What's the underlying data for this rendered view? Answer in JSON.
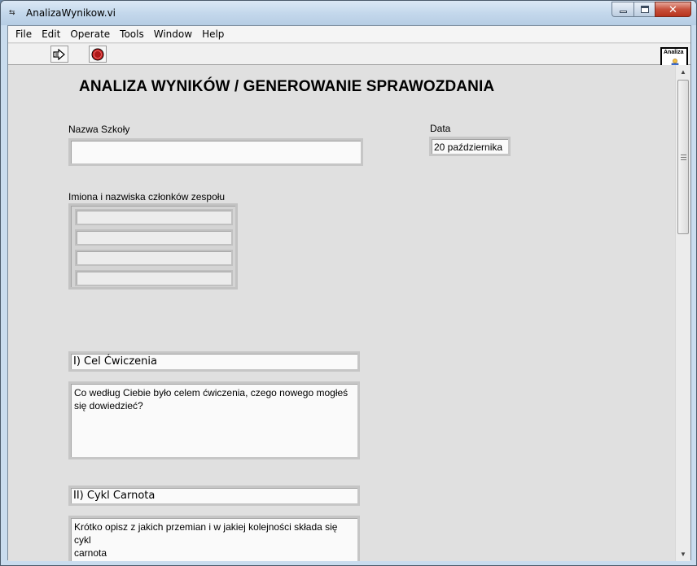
{
  "window": {
    "title": "AnalizaWynikow.vi",
    "title_icon": "labview-vi-icon"
  },
  "menu": {
    "items": [
      "File",
      "Edit",
      "Operate",
      "Tools",
      "Window",
      "Help"
    ]
  },
  "toolbar": {
    "run_icon": "run-arrow-icon",
    "abort_icon": "abort-execution-icon",
    "vi_icon_label": "Analiza"
  },
  "panel": {
    "heading": "ANALIZA WYNIKÓW / GENEROWANIE SPRAWOZDANIA",
    "school": {
      "label": "Nazwa Szkoły",
      "value": ""
    },
    "date": {
      "label": "Data",
      "value": "20 października"
    },
    "team": {
      "label": "Imiona i nazwiska członków zespołu",
      "members": [
        "",
        "",
        "",
        ""
      ]
    },
    "sections": [
      {
        "title": "I) Cel Ćwiczenia",
        "text": "Co według Ciebie było celem ćwiczenia, czego nowego mogłeś\nsię dowiedzieć?"
      },
      {
        "title": "II) Cykl Carnota",
        "text": "Krótko opisz z jakich przemian i w jakiej kolejności składa się cykl\ncarnota"
      }
    ]
  },
  "scrollbar": {
    "up_icon": "scroll-up-arrow-icon",
    "down_icon": "scroll-down-arrow-icon"
  },
  "colors": {
    "panel_bg": "#e0e0e0",
    "field_bg": "#fafafa",
    "abort_red": "#cc2222",
    "close_button_red": "#c7513c"
  }
}
